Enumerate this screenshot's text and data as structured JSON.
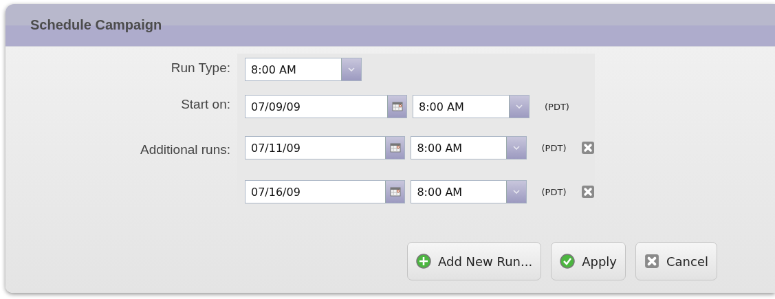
{
  "dialog": {
    "title": "Schedule Campaign"
  },
  "run_type": {
    "label": "Run Type:",
    "value": "8:00 AM"
  },
  "start": {
    "label": "Start on:",
    "date": "07/09/09",
    "time": "8:00 AM",
    "zone": "(PDT)"
  },
  "additional": {
    "label": "Additional runs:",
    "runs": [
      {
        "date": "07/11/09",
        "time": "8:00 AM",
        "zone": "(PDT)"
      },
      {
        "date": "07/16/09",
        "time": "8:00 AM",
        "zone": "(PDT)"
      }
    ]
  },
  "buttons": [
    {
      "label": "Add New Run...",
      "kind": "add"
    },
    {
      "label": "Apply",
      "kind": "apply"
    },
    {
      "label": "Cancel",
      "kind": "cancel"
    }
  ]
}
